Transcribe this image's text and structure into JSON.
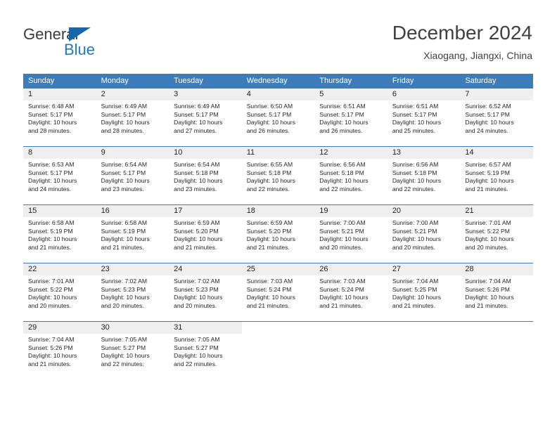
{
  "brand": {
    "name_part1": "General",
    "name_part2": "Blue",
    "triangle_icon": "triangle-logo-icon",
    "accent_color": "#2277c8",
    "triangle_color": "#1666ad"
  },
  "header": {
    "title": "December 2024",
    "subtitle": "Xiaogang, Jiangxi, China"
  },
  "calendar": {
    "header_bg": "#3c7cba",
    "daynum_bg": "#efefef",
    "weekdays": [
      "Sunday",
      "Monday",
      "Tuesday",
      "Wednesday",
      "Thursday",
      "Friday",
      "Saturday"
    ],
    "weeks": [
      [
        {
          "day": "1",
          "sunrise": "Sunrise: 6:48 AM",
          "sunset": "Sunset: 5:17 PM",
          "daylight1": "Daylight: 10 hours",
          "daylight2": "and 28 minutes."
        },
        {
          "day": "2",
          "sunrise": "Sunrise: 6:49 AM",
          "sunset": "Sunset: 5:17 PM",
          "daylight1": "Daylight: 10 hours",
          "daylight2": "and 28 minutes."
        },
        {
          "day": "3",
          "sunrise": "Sunrise: 6:49 AM",
          "sunset": "Sunset: 5:17 PM",
          "daylight1": "Daylight: 10 hours",
          "daylight2": "and 27 minutes."
        },
        {
          "day": "4",
          "sunrise": "Sunrise: 6:50 AM",
          "sunset": "Sunset: 5:17 PM",
          "daylight1": "Daylight: 10 hours",
          "daylight2": "and 26 minutes."
        },
        {
          "day": "5",
          "sunrise": "Sunrise: 6:51 AM",
          "sunset": "Sunset: 5:17 PM",
          "daylight1": "Daylight: 10 hours",
          "daylight2": "and 26 minutes."
        },
        {
          "day": "6",
          "sunrise": "Sunrise: 6:51 AM",
          "sunset": "Sunset: 5:17 PM",
          "daylight1": "Daylight: 10 hours",
          "daylight2": "and 25 minutes."
        },
        {
          "day": "7",
          "sunrise": "Sunrise: 6:52 AM",
          "sunset": "Sunset: 5:17 PM",
          "daylight1": "Daylight: 10 hours",
          "daylight2": "and 24 minutes."
        }
      ],
      [
        {
          "day": "8",
          "sunrise": "Sunrise: 6:53 AM",
          "sunset": "Sunset: 5:17 PM",
          "daylight1": "Daylight: 10 hours",
          "daylight2": "and 24 minutes."
        },
        {
          "day": "9",
          "sunrise": "Sunrise: 6:54 AM",
          "sunset": "Sunset: 5:17 PM",
          "daylight1": "Daylight: 10 hours",
          "daylight2": "and 23 minutes."
        },
        {
          "day": "10",
          "sunrise": "Sunrise: 6:54 AM",
          "sunset": "Sunset: 5:18 PM",
          "daylight1": "Daylight: 10 hours",
          "daylight2": "and 23 minutes."
        },
        {
          "day": "11",
          "sunrise": "Sunrise: 6:55 AM",
          "sunset": "Sunset: 5:18 PM",
          "daylight1": "Daylight: 10 hours",
          "daylight2": "and 22 minutes."
        },
        {
          "day": "12",
          "sunrise": "Sunrise: 6:56 AM",
          "sunset": "Sunset: 5:18 PM",
          "daylight1": "Daylight: 10 hours",
          "daylight2": "and 22 minutes."
        },
        {
          "day": "13",
          "sunrise": "Sunrise: 6:56 AM",
          "sunset": "Sunset: 5:18 PM",
          "daylight1": "Daylight: 10 hours",
          "daylight2": "and 22 minutes."
        },
        {
          "day": "14",
          "sunrise": "Sunrise: 6:57 AM",
          "sunset": "Sunset: 5:19 PM",
          "daylight1": "Daylight: 10 hours",
          "daylight2": "and 21 minutes."
        }
      ],
      [
        {
          "day": "15",
          "sunrise": "Sunrise: 6:58 AM",
          "sunset": "Sunset: 5:19 PM",
          "daylight1": "Daylight: 10 hours",
          "daylight2": "and 21 minutes."
        },
        {
          "day": "16",
          "sunrise": "Sunrise: 6:58 AM",
          "sunset": "Sunset: 5:19 PM",
          "daylight1": "Daylight: 10 hours",
          "daylight2": "and 21 minutes."
        },
        {
          "day": "17",
          "sunrise": "Sunrise: 6:59 AM",
          "sunset": "Sunset: 5:20 PM",
          "daylight1": "Daylight: 10 hours",
          "daylight2": "and 21 minutes."
        },
        {
          "day": "18",
          "sunrise": "Sunrise: 6:59 AM",
          "sunset": "Sunset: 5:20 PM",
          "daylight1": "Daylight: 10 hours",
          "daylight2": "and 21 minutes."
        },
        {
          "day": "19",
          "sunrise": "Sunrise: 7:00 AM",
          "sunset": "Sunset: 5:21 PM",
          "daylight1": "Daylight: 10 hours",
          "daylight2": "and 20 minutes."
        },
        {
          "day": "20",
          "sunrise": "Sunrise: 7:00 AM",
          "sunset": "Sunset: 5:21 PM",
          "daylight1": "Daylight: 10 hours",
          "daylight2": "and 20 minutes."
        },
        {
          "day": "21",
          "sunrise": "Sunrise: 7:01 AM",
          "sunset": "Sunset: 5:22 PM",
          "daylight1": "Daylight: 10 hours",
          "daylight2": "and 20 minutes."
        }
      ],
      [
        {
          "day": "22",
          "sunrise": "Sunrise: 7:01 AM",
          "sunset": "Sunset: 5:22 PM",
          "daylight1": "Daylight: 10 hours",
          "daylight2": "and 20 minutes."
        },
        {
          "day": "23",
          "sunrise": "Sunrise: 7:02 AM",
          "sunset": "Sunset: 5:23 PM",
          "daylight1": "Daylight: 10 hours",
          "daylight2": "and 20 minutes."
        },
        {
          "day": "24",
          "sunrise": "Sunrise: 7:02 AM",
          "sunset": "Sunset: 5:23 PM",
          "daylight1": "Daylight: 10 hours",
          "daylight2": "and 20 minutes."
        },
        {
          "day": "25",
          "sunrise": "Sunrise: 7:03 AM",
          "sunset": "Sunset: 5:24 PM",
          "daylight1": "Daylight: 10 hours",
          "daylight2": "and 21 minutes."
        },
        {
          "day": "26",
          "sunrise": "Sunrise: 7:03 AM",
          "sunset": "Sunset: 5:24 PM",
          "daylight1": "Daylight: 10 hours",
          "daylight2": "and 21 minutes."
        },
        {
          "day": "27",
          "sunrise": "Sunrise: 7:04 AM",
          "sunset": "Sunset: 5:25 PM",
          "daylight1": "Daylight: 10 hours",
          "daylight2": "and 21 minutes."
        },
        {
          "day": "28",
          "sunrise": "Sunrise: 7:04 AM",
          "sunset": "Sunset: 5:26 PM",
          "daylight1": "Daylight: 10 hours",
          "daylight2": "and 21 minutes."
        }
      ],
      [
        {
          "day": "29",
          "sunrise": "Sunrise: 7:04 AM",
          "sunset": "Sunset: 5:26 PM",
          "daylight1": "Daylight: 10 hours",
          "daylight2": "and 21 minutes."
        },
        {
          "day": "30",
          "sunrise": "Sunrise: 7:05 AM",
          "sunset": "Sunset: 5:27 PM",
          "daylight1": "Daylight: 10 hours",
          "daylight2": "and 22 minutes."
        },
        {
          "day": "31",
          "sunrise": "Sunrise: 7:05 AM",
          "sunset": "Sunset: 5:27 PM",
          "daylight1": "Daylight: 10 hours",
          "daylight2": "and 22 minutes."
        },
        {
          "day": "",
          "sunrise": "",
          "sunset": "",
          "daylight1": "",
          "daylight2": ""
        },
        {
          "day": "",
          "sunrise": "",
          "sunset": "",
          "daylight1": "",
          "daylight2": ""
        },
        {
          "day": "",
          "sunrise": "",
          "sunset": "",
          "daylight1": "",
          "daylight2": ""
        },
        {
          "day": "",
          "sunrise": "",
          "sunset": "",
          "daylight1": "",
          "daylight2": ""
        }
      ]
    ]
  }
}
